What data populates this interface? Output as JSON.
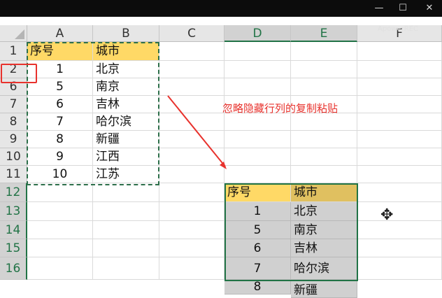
{
  "window": {
    "controls": [
      "—",
      "☐",
      "✕"
    ],
    "watermark": "ApowerREC"
  },
  "columns": [
    "A",
    "B",
    "C",
    "D",
    "E",
    "F"
  ],
  "rows": [
    1,
    2,
    6,
    7,
    8,
    9,
    10,
    11,
    12,
    13,
    14,
    15,
    16
  ],
  "source_table": {
    "header": [
      "序号",
      "城市"
    ],
    "rows": [
      [
        "1",
        "北京"
      ],
      [
        "5",
        "南京"
      ],
      [
        "6",
        "吉林"
      ],
      [
        "7",
        "哈尔滨"
      ],
      [
        "8",
        "新疆"
      ],
      [
        "9",
        "江西"
      ],
      [
        "10",
        "江苏"
      ]
    ]
  },
  "pasted_table": {
    "header": [
      "序号",
      "城市"
    ],
    "rows": [
      [
        "1",
        "北京"
      ],
      [
        "5",
        "南京"
      ],
      [
        "6",
        "吉林"
      ],
      [
        "7",
        "哈尔滨"
      ],
      [
        "8",
        "新疆"
      ]
    ]
  },
  "annotation": "忽略隐藏行列的复制粘贴",
  "colors": {
    "header_fill": "#ffd966",
    "pasted_header_fill": "#e0c060",
    "pasted_body_fill": "#d0d0d0",
    "annotation": "#e8322d",
    "selection": "#217346"
  },
  "icons": {
    "row_hidden_marker": "red-rectangle",
    "cursor": "cross-cursor-icon"
  }
}
